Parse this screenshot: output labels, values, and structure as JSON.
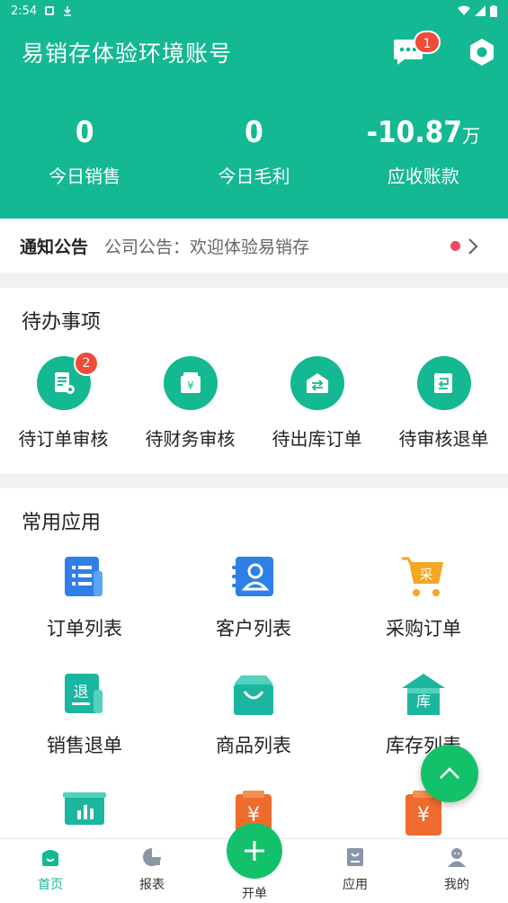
{
  "status_bar": {
    "time": "2:54"
  },
  "header": {
    "title": "易销存体验环境账号",
    "message_badge": "1",
    "stats": [
      {
        "value": "0",
        "unit": "",
        "label": "今日销售"
      },
      {
        "value": "0",
        "unit": "",
        "label": "今日毛利"
      },
      {
        "value": "-10.87",
        "unit": "万",
        "label": "应收账款"
      }
    ]
  },
  "notice": {
    "title": "通知公告",
    "text": "公司公告：欢迎体验易销存"
  },
  "todo": {
    "title": "待办事项",
    "items": [
      {
        "label": "待订单审核",
        "badge": "2",
        "icon": "order-review-icon"
      },
      {
        "label": "待财务审核",
        "badge": "",
        "icon": "finance-review-icon"
      },
      {
        "label": "待出库订单",
        "badge": "",
        "icon": "outbound-icon"
      },
      {
        "label": "待审核退单",
        "badge": "",
        "icon": "return-review-icon"
      }
    ]
  },
  "apps": {
    "title": "常用应用",
    "items": [
      {
        "label": "订单列表",
        "icon": "order-list-icon"
      },
      {
        "label": "客户列表",
        "icon": "customer-list-icon"
      },
      {
        "label": "采购订单",
        "icon": "purchase-cart-icon",
        "glyph": "采"
      },
      {
        "label": "销售退单",
        "icon": "sales-return-icon",
        "glyph": "退"
      },
      {
        "label": "商品列表",
        "icon": "product-bag-icon"
      },
      {
        "label": "库存列表",
        "icon": "warehouse-icon",
        "glyph": "库"
      }
    ]
  },
  "tabbar": {
    "home": "首页",
    "report": "报表",
    "create": "开单",
    "apps": "应用",
    "mine": "我的"
  },
  "colors": {
    "primary": "#14b892",
    "accent_green": "#12c16a",
    "badge_red": "#f04b3a"
  }
}
